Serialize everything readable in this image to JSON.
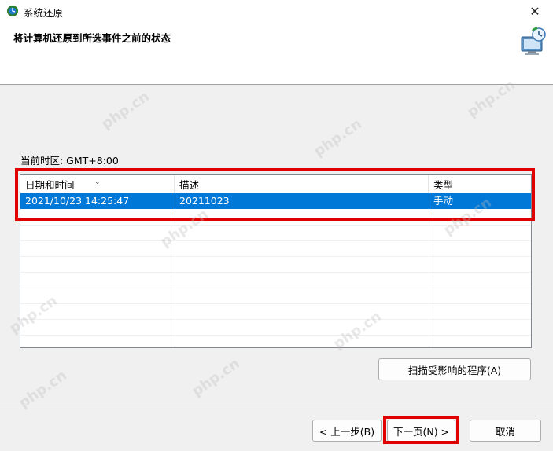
{
  "window": {
    "title": "系统还原",
    "close_glyph": "✕"
  },
  "header": {
    "title": "将计算机还原到所选事件之前的状态",
    "icon": "system-restore-icon"
  },
  "timezone": {
    "label": "当前时区: GMT+8:00"
  },
  "table": {
    "columns": [
      "日期和时间",
      "描述",
      "类型"
    ],
    "sort_glyph": "⌄",
    "rows": [
      {
        "datetime": "2021/10/23 14:25:47",
        "description": "20211023",
        "type": "手动",
        "selected": true
      }
    ]
  },
  "buttons": {
    "scan": "扫描受影响的程序(A)",
    "back": "< 上一步(B)",
    "next": "下一页(N) >",
    "cancel": "取消"
  },
  "colors": {
    "selection": "#0078d7",
    "highlight": "#e00000"
  }
}
